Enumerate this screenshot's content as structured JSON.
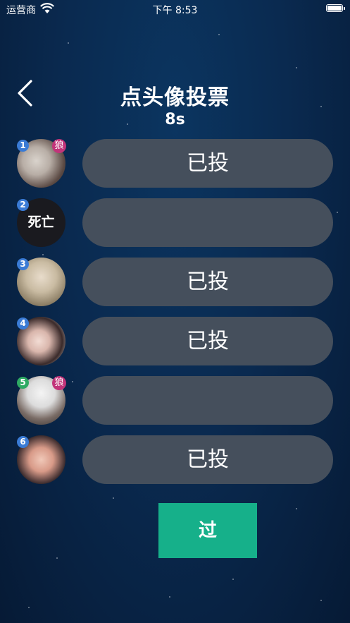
{
  "status_bar": {
    "carrier": "运营商",
    "time": "下午 8:53"
  },
  "header": {
    "title": "点头像投票",
    "countdown": "8s"
  },
  "players": [
    {
      "seat": "1",
      "badge_color": "#3a7bd5",
      "wolf": "狼",
      "vote_label": "已投",
      "dead_label": ""
    },
    {
      "seat": "2",
      "badge_color": "#3a7bd5",
      "wolf": "",
      "vote_label": "",
      "dead_label": "死亡"
    },
    {
      "seat": "3",
      "badge_color": "#3a7bd5",
      "wolf": "",
      "vote_label": "已投",
      "dead_label": ""
    },
    {
      "seat": "4",
      "badge_color": "#3a7bd5",
      "wolf": "",
      "vote_label": "已投",
      "dead_label": ""
    },
    {
      "seat": "5",
      "badge_color": "#2eaa63",
      "wolf": "狼",
      "vote_label": "",
      "dead_label": ""
    },
    {
      "seat": "6",
      "badge_color": "#3a7bd5",
      "wolf": "",
      "vote_label": "已投",
      "dead_label": ""
    }
  ],
  "pass_button": "过",
  "colors": {
    "background": "#0a2a50",
    "pill": "#454f5c",
    "pass": "#16b08a",
    "wolf_badge": "#c2347a"
  }
}
